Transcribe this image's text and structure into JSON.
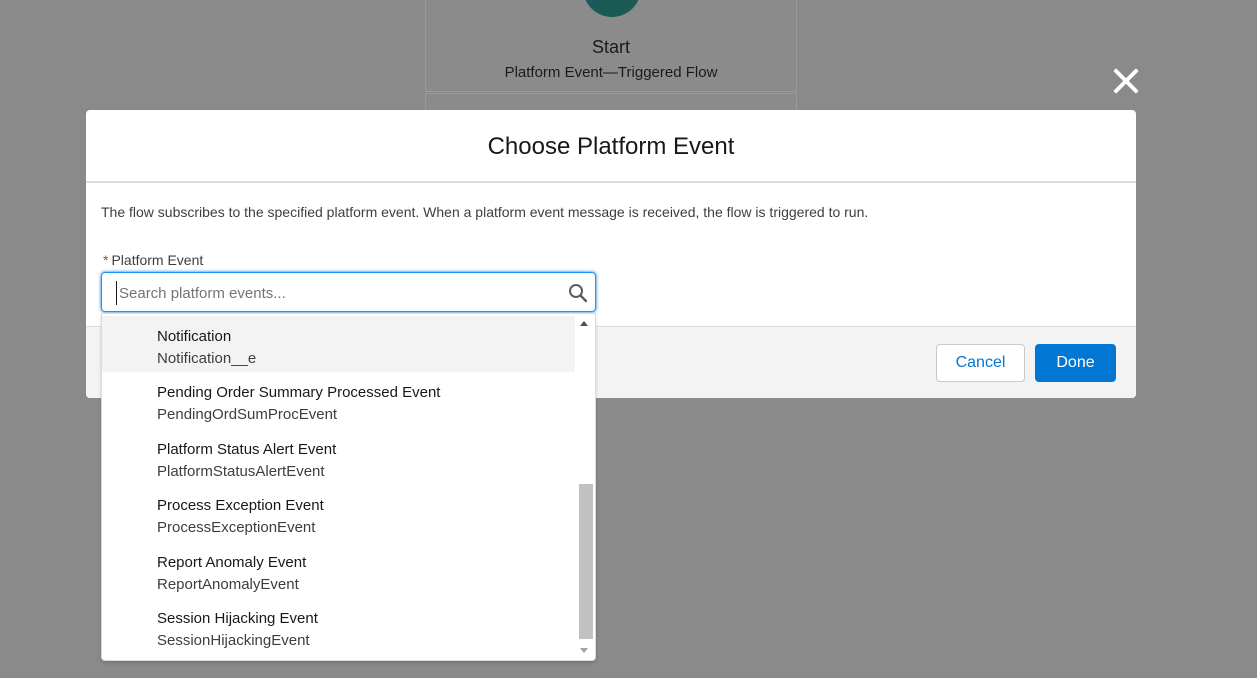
{
  "background": {
    "start_title": "Start",
    "start_subtitle": "Platform Event—Triggered Flow"
  },
  "modal": {
    "title": "Choose Platform Event",
    "description": "The flow subscribes to the specified platform event. When a platform event message is received, the flow is triggered to run.",
    "field_label": "Platform Event",
    "required_marker": "*",
    "search_placeholder": "Search platform events...",
    "search_value": "",
    "cancel_label": "Cancel",
    "done_label": "Done"
  },
  "dropdown": {
    "options": [
      {
        "label": "Notification",
        "api_name": "Notification__e",
        "highlighted": true
      },
      {
        "label": "Pending Order Summary Processed Event",
        "api_name": "PendingOrdSumProcEvent"
      },
      {
        "label": "Platform Status Alert Event",
        "api_name": "PlatformStatusAlertEvent"
      },
      {
        "label": "Process Exception Event",
        "api_name": "ProcessExceptionEvent"
      },
      {
        "label": "Report Anomaly Event",
        "api_name": "ReportAnomalyEvent"
      },
      {
        "label": "Session Hijacking Event",
        "api_name": "SessionHijackingEvent"
      }
    ]
  },
  "colors": {
    "overlay": "#8a8a8a",
    "brand": "#0176d3",
    "start_icon": "#1a5b56"
  },
  "icons": {
    "close": "close-icon",
    "search": "search-icon"
  }
}
